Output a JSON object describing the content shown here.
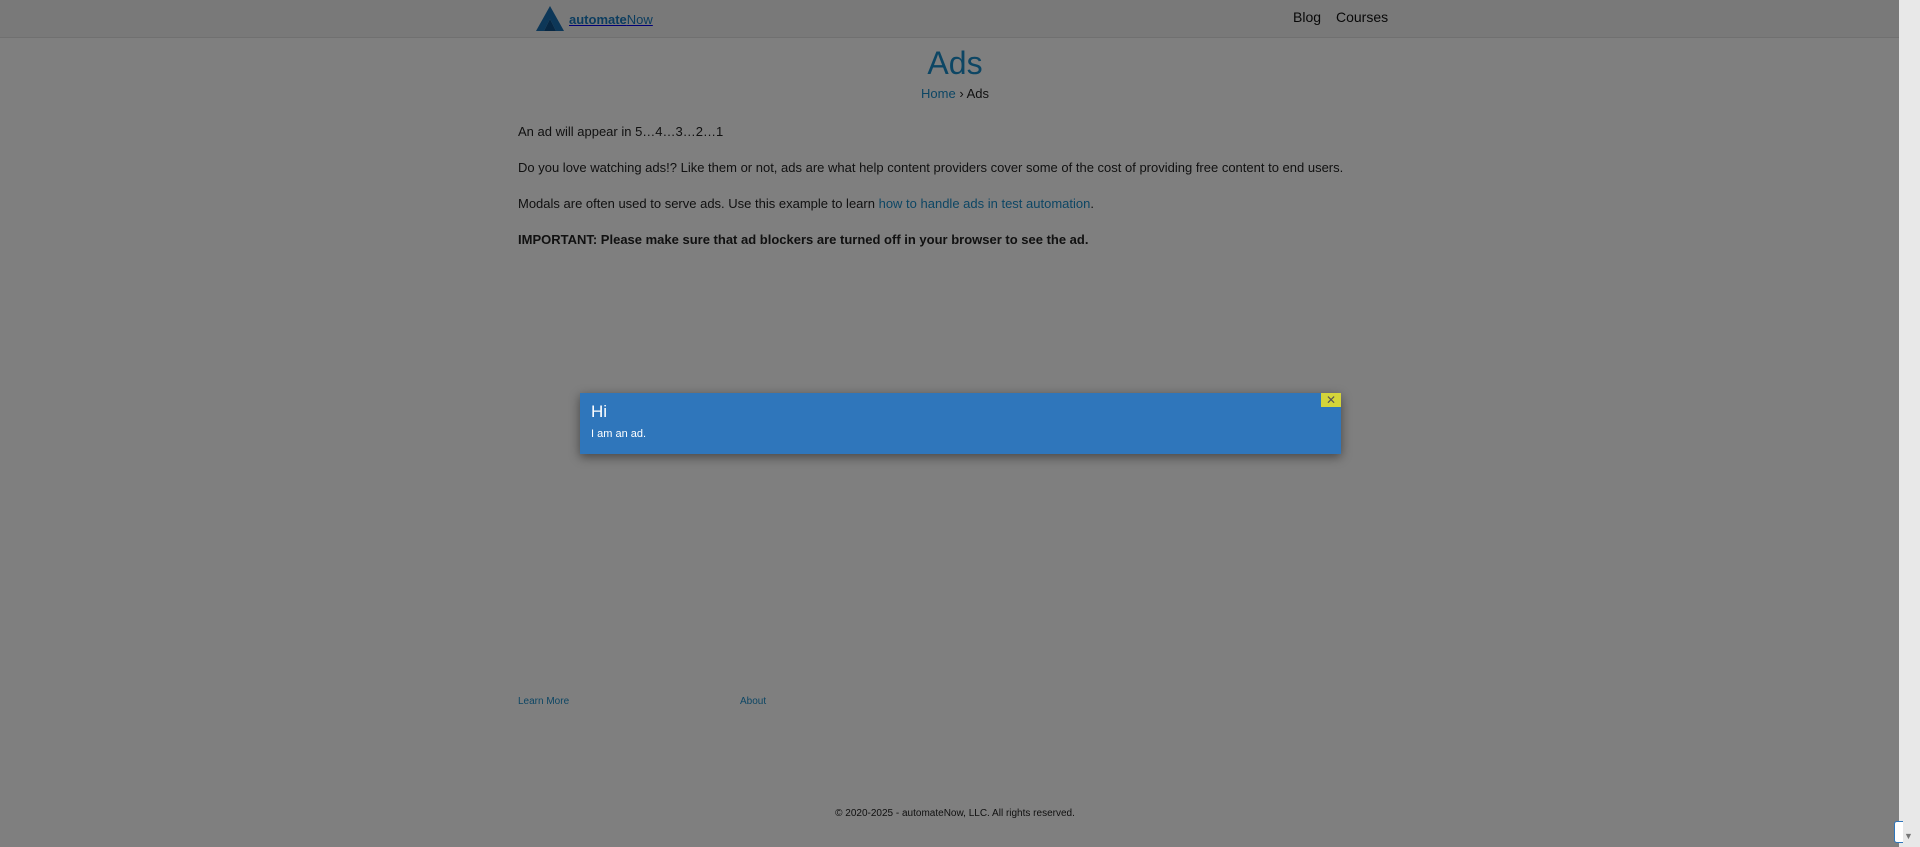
{
  "header": {
    "logo_bold": "automate",
    "logo_light": "Now",
    "nav": {
      "blog": "Blog",
      "courses": "Courses"
    }
  },
  "page": {
    "title": "Ads",
    "breadcrumb": {
      "home": "Home",
      "separator": " › ",
      "current": "Ads"
    }
  },
  "content": {
    "countdown": "An ad will appear in 5…4…3…2…1",
    "intro": "Do you love watching ads!? Like them or not, ads are what help content providers cover some of the cost of providing free content to end users.",
    "modals_prefix": "Modals are often used to serve ads. Use this example to learn ",
    "modals_link": "how to handle ads in test automation",
    "modals_suffix": ".",
    "important": "IMPORTANT: Please make sure that ad blockers are turned off in your browser to see the ad."
  },
  "footer": {
    "learn_more": "Learn More",
    "about": "About",
    "copyright": "© 2020-2025 - automateNow, LLC. All rights reserved."
  },
  "ad_modal": {
    "title": "Hi",
    "body": "I am an ad.",
    "close_glyph": "✕"
  },
  "colors": {
    "accent": "#1a8cc8",
    "modal_bg": "#2f76bb",
    "close_button": "#d4d43a",
    "overlay": "rgba(0,0,0,0.5)"
  },
  "icons": [
    "automatenow-logo-icon",
    "close-icon",
    "scroll-down-arrow-icon"
  ]
}
